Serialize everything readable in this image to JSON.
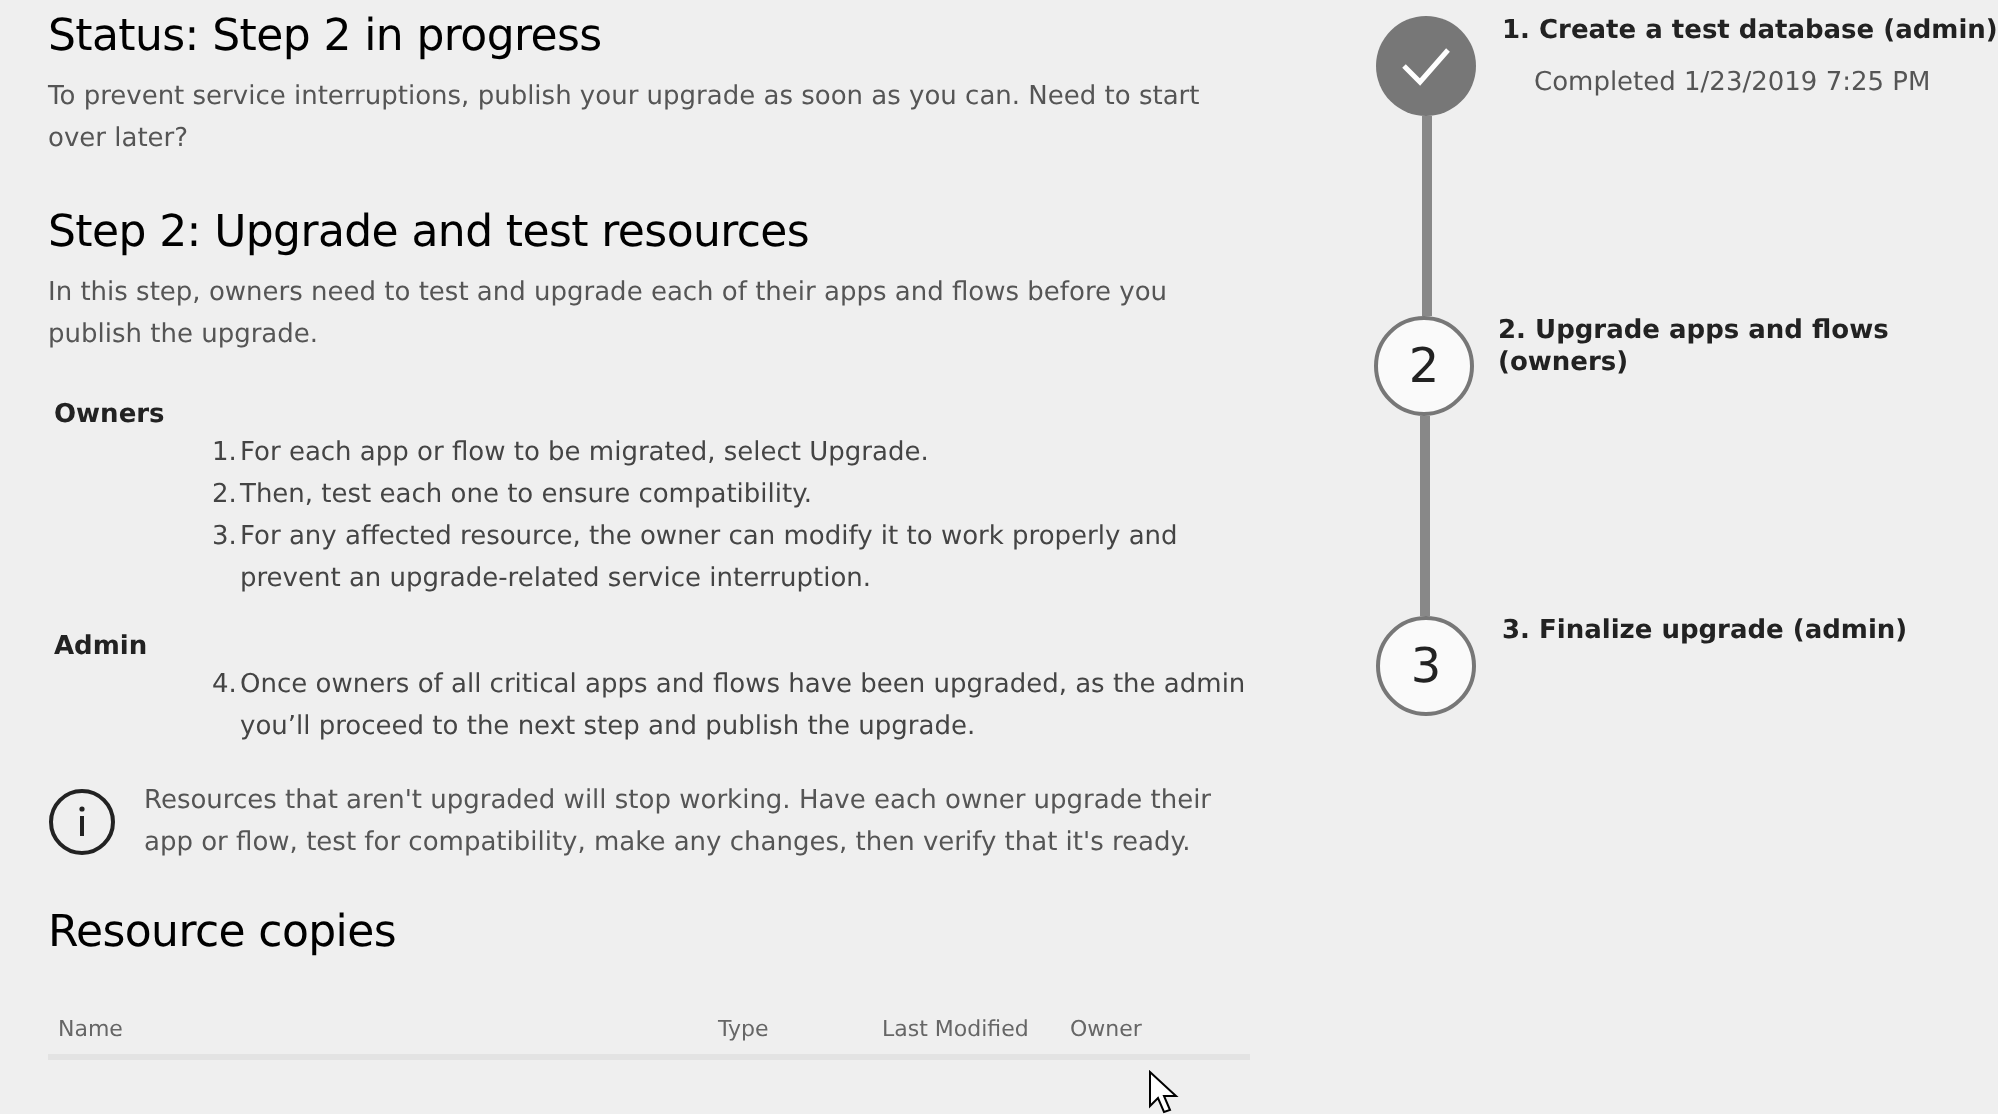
{
  "status_title": "Status: Step 2 in progress",
  "status_text": "To prevent service interruptions, publish your upgrade as soon as you can. Need to start over later?",
  "step_title": "Step 2: Upgrade and test resources",
  "step_text": "In this step, owners need to test and upgrade each of their apps and flows before you publish the upgrade.",
  "roles": [
    {
      "name": "Owners",
      "items": [
        {
          "number": "1.",
          "text": "For each app or flow to be migrated, select Upgrade."
        },
        {
          "number": "2.",
          "text": "Then, test each one to ensure compatibility."
        },
        {
          "number": "3.",
          "text": "For any affected resource, the owner can modify it to work properly and prevent an upgrade-related service interruption."
        }
      ]
    },
    {
      "name": "Admin",
      "items": [
        {
          "number": "4.",
          "text": "Once owners of all critical apps and flows have been upgraded, as the admin you’ll proceed to the next step and publish the upgrade."
        }
      ]
    }
  ],
  "notice": "Resources that aren't upgraded will stop working. Have each owner upgrade their app or flow, test for compatibility, make any changes, then verify that it's ready.",
  "resource_title": "Resource copies",
  "table": {
    "columns": [
      "Name",
      "Type",
      "Last Modified",
      "Owner"
    ]
  },
  "steps": [
    {
      "completed": true,
      "label": "1. Create a test database (admin)",
      "detail": "Completed 1/23/2019 7:25 PM"
    },
    {
      "completed": false,
      "marker": "2",
      "label": "2. Upgrade apps and flows (owners)"
    },
    {
      "completed": false,
      "marker": "3",
      "label": "3. Finalize upgrade (admin)"
    }
  ]
}
